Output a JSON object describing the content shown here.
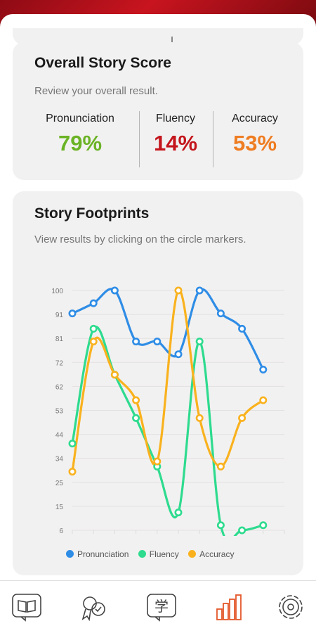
{
  "colors": {
    "pronunciation": "#2f8de6",
    "fluency": "#2edb8f",
    "accuracy": "#f9b21e",
    "score_pronunciation": "#6ab325",
    "score_fluency": "#c4151c",
    "score_accuracy": "#ee7d22",
    "brand": "#c4151c"
  },
  "overall": {
    "title": "Overall Story Score",
    "subtitle": "Review your overall result.",
    "scores": [
      {
        "label": "Pronunciation",
        "value": "79%"
      },
      {
        "label": "Fluency",
        "value": "14%"
      },
      {
        "label": "Accuracy",
        "value": "53%"
      }
    ]
  },
  "footprints": {
    "title": "Story Footprints",
    "subtitle": "View results by clicking on the circle markers."
  },
  "chart_data": {
    "type": "line",
    "title": "",
    "xlabel": "",
    "ylabel": "",
    "ylim": [
      6,
      100
    ],
    "yticks": [
      "100",
      "91",
      "81",
      "72",
      "62",
      "53",
      "44",
      "34",
      "25",
      "15",
      "6"
    ],
    "x": [
      1,
      2,
      3,
      4,
      5,
      6,
      7,
      8,
      9,
      10,
      11
    ],
    "series": [
      {
        "name": "Pronunciation",
        "values": [
          91,
          95,
          100,
          80,
          80,
          75,
          100,
          91,
          85,
          69,
          null
        ]
      },
      {
        "name": "Fluency",
        "values": [
          40,
          85,
          67,
          50,
          31,
          13,
          80,
          8,
          6,
          8,
          null
        ]
      },
      {
        "name": "Accuracy",
        "values": [
          29,
          80,
          67,
          57,
          33,
          100,
          50,
          31,
          50,
          57,
          null
        ]
      }
    ],
    "grid": true,
    "legend": "bottom"
  },
  "nav": {
    "icons": [
      "book-icon",
      "badge-icon",
      "translate-icon",
      "chart-icon",
      "settings-icon"
    ],
    "active": "chart-icon",
    "translate_glyph": "学"
  }
}
